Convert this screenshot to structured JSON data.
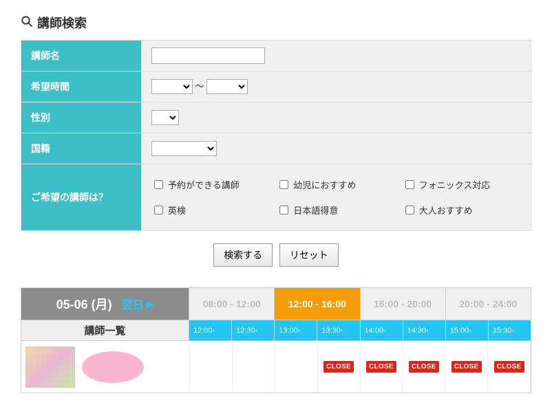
{
  "search_title": "講師検索",
  "form": {
    "name": {
      "label": "講師名",
      "value": ""
    },
    "time": {
      "label": "希望時間",
      "from": "",
      "to": "",
      "separator": "～"
    },
    "gender": {
      "label": "性別",
      "value": ""
    },
    "nationality": {
      "label": "国籍",
      "value": ""
    },
    "preference": {
      "label": "ご希望の講師は？",
      "options": [
        "予約ができる講師",
        "幼児におすすめ",
        "フォニックス対応",
        "英検",
        "日本語得意",
        "大人おすすめ"
      ]
    }
  },
  "buttons": {
    "search": "検索する",
    "reset": "リセット"
  },
  "schedule": {
    "date": "05-06 (月)",
    "next_day": "翌日",
    "ranges": [
      {
        "label": "08:00 - 12:00",
        "active": false
      },
      {
        "label": "12:00 - 16:00",
        "active": true
      },
      {
        "label": "16:00 - 20:00",
        "active": false
      },
      {
        "label": "20:00 - 24:00",
        "active": false
      }
    ],
    "teacher_list_header": "講師一覧",
    "slots": [
      "12:00-",
      "12:30-",
      "13:00-",
      "13:30-",
      "14:00-",
      "14:30-",
      "15:00-",
      "15:30-"
    ],
    "rows": [
      {
        "teacher_name": "",
        "cells": [
          "",
          "",
          "",
          "CLOSE",
          "CLOSE",
          "CLOSE",
          "CLOSE",
          "CLOSE"
        ]
      }
    ]
  }
}
